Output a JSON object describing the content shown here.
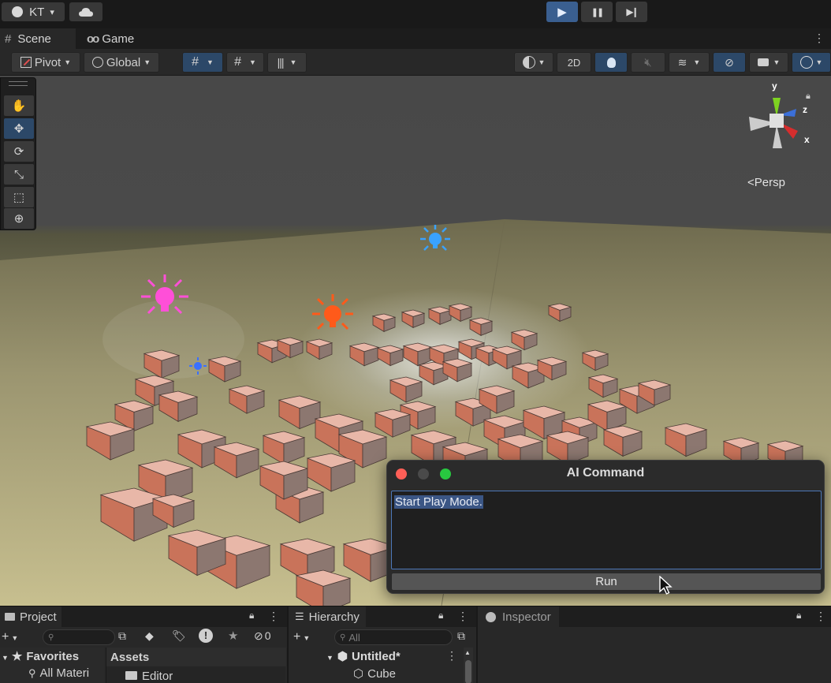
{
  "topbar": {
    "account_label": "KT",
    "account_caret": "▾",
    "cloud_icon": "cloud-icon",
    "play_icon": "▶",
    "pause_icon": "❚❚",
    "step_icon": "▶❙"
  },
  "tabs": [
    {
      "label": "Scene",
      "icon": "#"
    },
    {
      "label": "Game",
      "icon": "oo"
    }
  ],
  "scene_toolbar": {
    "pivot_label": "Pivot",
    "global_label": "Global",
    "mode_2d_label": "2D"
  },
  "tools": [
    {
      "name": "hand-tool",
      "glyph": "✋"
    },
    {
      "name": "move-tool",
      "glyph": "✥"
    },
    {
      "name": "rotate-tool",
      "glyph": "⟳"
    },
    {
      "name": "scale-tool",
      "glyph": "⤡"
    },
    {
      "name": "rect-tool",
      "glyph": "⬚"
    },
    {
      "name": "transform-tool",
      "glyph": "⊕"
    }
  ],
  "gizmo": {
    "axis_y": "y",
    "axis_z": "z",
    "axis_x": "x",
    "projection_label": "Persp",
    "projection_prefix": "<"
  },
  "ai_window": {
    "title": "AI Command",
    "input_value": "Start Play Mode.",
    "run_label": "Run"
  },
  "project_panel": {
    "title": "Project",
    "favorites_label": "Favorites",
    "all_materials_label": "All Materi",
    "assets_label": "Assets",
    "editor_folder_label": "Editor",
    "hidden_count": "0"
  },
  "hierarchy_panel": {
    "title": "Hierarchy",
    "search_placeholder": "All",
    "scene_name": "Untitled*",
    "child_item": "Cube"
  },
  "inspector_panel": {
    "title": "Inspector"
  },
  "colors": {
    "accent_blue": "#3a5f90",
    "light_magenta": "#ff4fd8",
    "light_orange": "#ff5a1a",
    "light_blue": "#3aa2ff",
    "cube_top": "#e8b7a8",
    "cube_side": "#c9735a"
  }
}
